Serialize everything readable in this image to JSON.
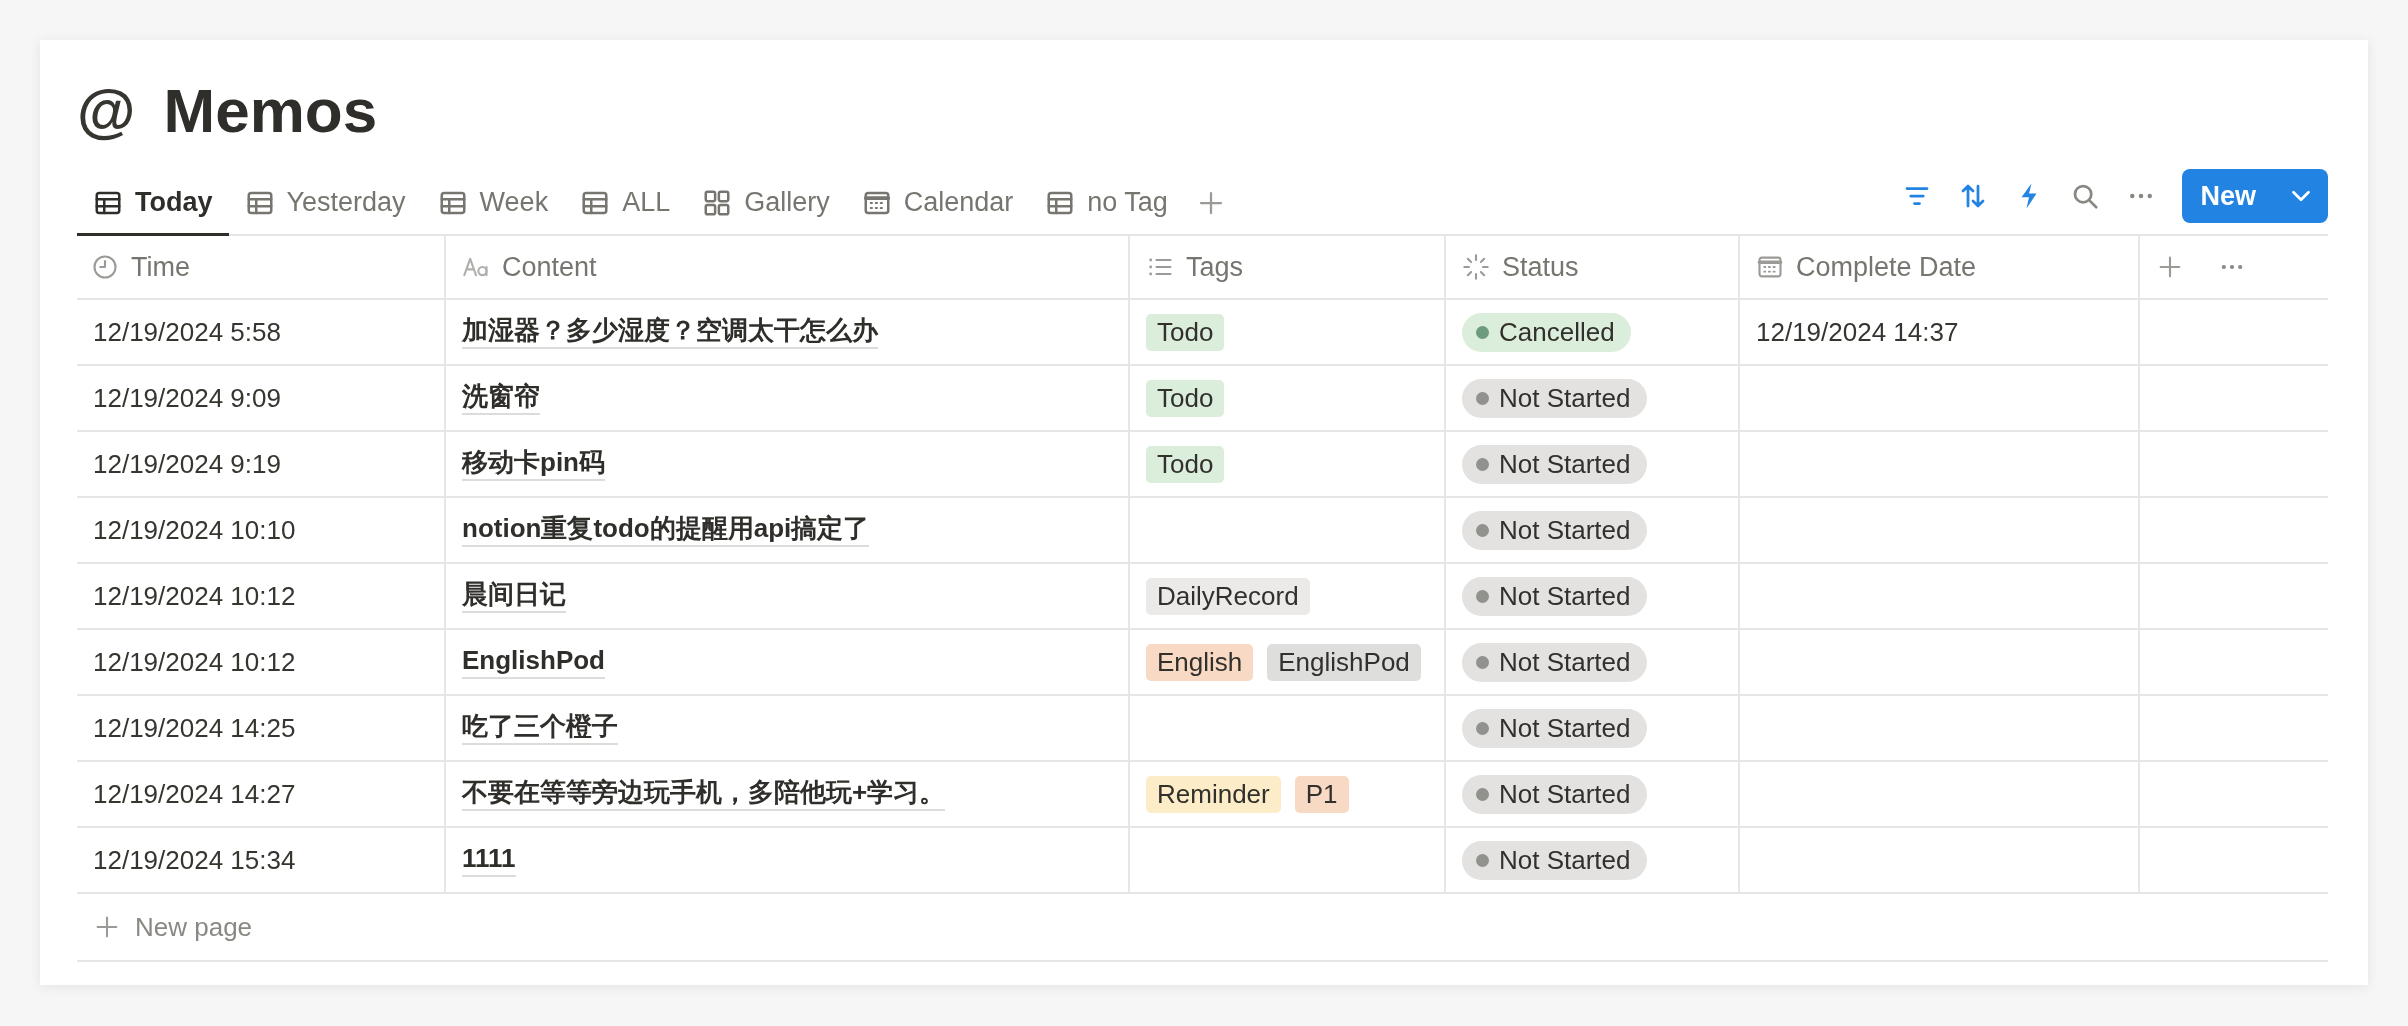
{
  "page": {
    "icon": "@",
    "title": "Memos"
  },
  "tabs": [
    {
      "label": "Today",
      "kind": "table",
      "selected": true
    },
    {
      "label": "Yesterday",
      "kind": "table",
      "selected": false
    },
    {
      "label": "Week",
      "kind": "table",
      "selected": false
    },
    {
      "label": "ALL",
      "kind": "table",
      "selected": false
    },
    {
      "label": "Gallery",
      "kind": "gallery",
      "selected": false
    },
    {
      "label": "Calendar",
      "kind": "calendar",
      "selected": false
    },
    {
      "label": "no Tag",
      "kind": "table",
      "selected": false
    }
  ],
  "toolbar": {
    "new_button": "New"
  },
  "table": {
    "columns": [
      {
        "label": "Time",
        "kind": "clock"
      },
      {
        "label": "Content",
        "kind": "text"
      },
      {
        "label": "Tags",
        "kind": "list"
      },
      {
        "label": "Status",
        "kind": "status"
      },
      {
        "label": "Complete Date",
        "kind": "date"
      }
    ],
    "rows": [
      {
        "time": "12/19/2024 5:58",
        "content": "加湿器？多少湿度？空调太干怎么办",
        "tags": [
          {
            "label": "Todo",
            "color": "#dbeddb"
          }
        ],
        "status": {
          "label": "Cancelled",
          "color": "#6c9b7d"
        },
        "complete_date": "12/19/2024 14:37"
      },
      {
        "time": "12/19/2024 9:09",
        "content": "洗窗帘",
        "tags": [
          {
            "label": "Todo",
            "color": "#dbeddb"
          }
        ],
        "status": {
          "label": "Not Started",
          "color": "#91918e"
        }
      },
      {
        "time": "12/19/2024 9:19",
        "content": "移动卡pin码",
        "tags": [
          {
            "label": "Todo",
            "color": "#dbeddb"
          }
        ],
        "status": {
          "label": "Not Started",
          "color": "#91918e"
        }
      },
      {
        "time": "12/19/2024 10:10",
        "content": "notion重复todo的提醒用api搞定了",
        "status": {
          "label": "Not Started",
          "color": "#91918e"
        }
      },
      {
        "time": "12/19/2024 10:12",
        "content": "晨间日记",
        "tags": [
          {
            "label": "DailyRecord",
            "color": "#ebeae8"
          }
        ],
        "status": {
          "label": "Not Started",
          "color": "#91918e"
        }
      },
      {
        "time": "12/19/2024 10:12",
        "content": "EnglishPod",
        "tags": [
          {
            "label": "English",
            "color": "#f8d9c4"
          },
          {
            "label": "EnglishPod",
            "color": "#dededc"
          }
        ],
        "status": {
          "label": "Not Started",
          "color": "#91918e"
        }
      },
      {
        "time": "12/19/2024 14:25",
        "content": "吃了三个橙子",
        "status": {
          "label": "Not Started",
          "color": "#91918e"
        }
      },
      {
        "time": "12/19/2024 14:27",
        "content": "不要在等等旁边玩手机，多陪他玩+学习。",
        "tags": [
          {
            "label": "Reminder",
            "color": "#fdecc8"
          },
          {
            "label": "P1",
            "color": "#f8d9c4"
          }
        ],
        "status": {
          "label": "Not Started",
          "color": "#91918e"
        }
      },
      {
        "time": "12/19/2024 15:34",
        "content": "1111",
        "status": {
          "label": "Not Started",
          "color": "#91918e"
        }
      }
    ],
    "new_row": "New page"
  }
}
